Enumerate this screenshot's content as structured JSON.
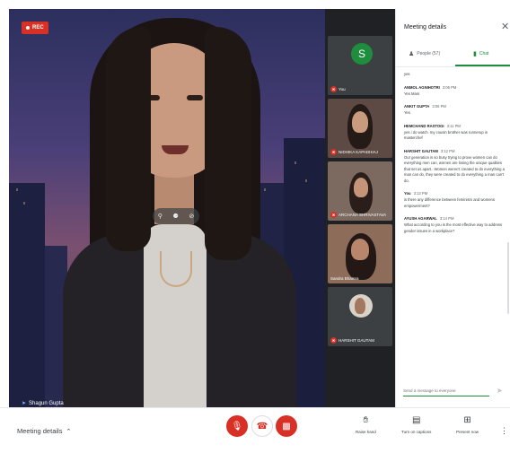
{
  "main_video": {
    "rec_label": "REC",
    "speaker_name": "Shagun Gupta"
  },
  "tiles": [
    {
      "name": "You",
      "avatar_letter": "S"
    },
    {
      "name": "NIDHIKA KAPADHIAJ"
    },
    {
      "name": "ARCHANA SHRIVASTAVA"
    },
    {
      "name": "Sandra Bhamra"
    },
    {
      "name": "HARSHIT GAUTAM"
    }
  ],
  "panel": {
    "title": "Meeting details",
    "tab_people": "People (57)",
    "tab_chat": "Chat",
    "input_placeholder": "Send a message to everyone"
  },
  "messages": [
    {
      "text": "yes"
    },
    {
      "sender": "ANMOL AGNIHOTRI",
      "time": "3:06 PM",
      "text": "Yes Mam"
    },
    {
      "sender": "ANKIT GUPTA",
      "time": "3:06 PM",
      "text": "Yes"
    },
    {
      "sender": "HEMCHAND RASTOGI",
      "time": "3:11 PM",
      "text": "yes i do watch. my cousin brother was runnerup in masterchef"
    },
    {
      "sender": "HARSHIT GAUTAM",
      "time": "3:12 PM",
      "text": "Our generation is so busy trying to prove women can do everything men can, women are losing the unique qualities that set us apart.. Women weren't created to do everything a man can do, they were created to do everything a man can't do."
    },
    {
      "sender": "You",
      "time": "3:13 PM",
      "text": "is there any difference between feminism and womens empowerment?"
    },
    {
      "sender": "AYUSH AGARWAL",
      "time": "3:14 PM",
      "text": "What according to you is the most effective way to address gender issues in a workplace?"
    }
  ],
  "bottom_bar": {
    "meeting_details": "Meeting details",
    "raise_hand": "Raise hand",
    "captions": "Turn on captions",
    "present": "Present now"
  },
  "icons": {
    "mic_off": "mic-off-icon",
    "hangup": "phone-hangup-icon",
    "cam_off": "camera-off-icon",
    "raise_hand": "hand-icon",
    "captions": "captions-icon",
    "present": "present-icon",
    "more": "more-vert-icon",
    "close": "close-icon",
    "people": "people-icon",
    "chat": "chat-icon",
    "send": "send-icon"
  },
  "colors": {
    "accent": "#1e8e3e",
    "danger": "#d93025"
  }
}
